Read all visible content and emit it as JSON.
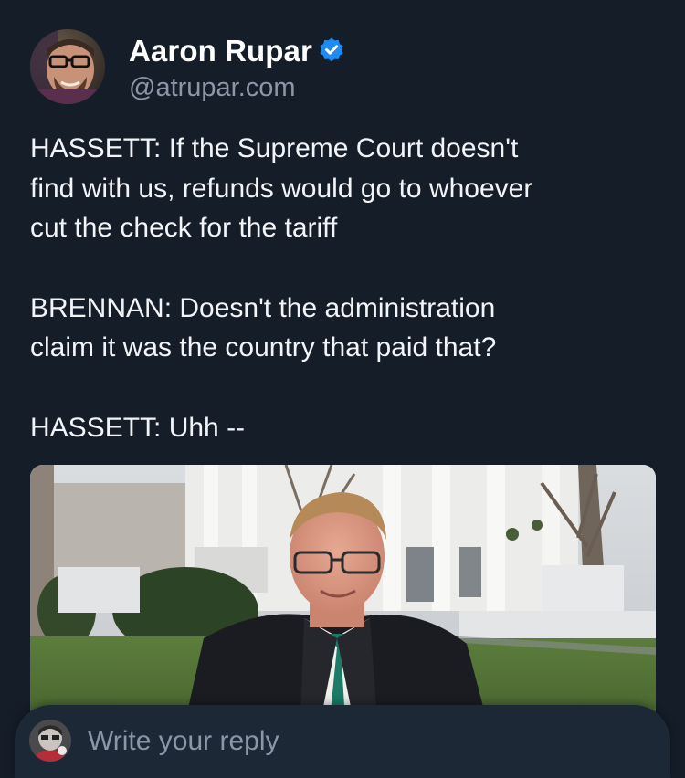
{
  "post": {
    "author": {
      "name": "Aaron Rupar",
      "handle": "@atrupar.com",
      "verified_color": "#1d8bf1"
    },
    "text_paragraphs": [
      [
        "HASSETT: If the Supreme Court doesn't",
        "find with us, refunds would go to whoever",
        "cut the check for the tariff"
      ],
      [
        "BRENNAN: Doesn't the administration",
        "claim it was the country that paid that?"
      ],
      [
        "HASSETT: Uhh --"
      ]
    ],
    "media": {
      "kind": "video-still"
    }
  },
  "reply": {
    "placeholder": "Write your reply"
  },
  "colors": {
    "background": "#151d29",
    "reply_bar": "#1d2837",
    "text": "#f2f4f7",
    "muted": "#8b96a6",
    "accent": "#1d8bf1"
  }
}
